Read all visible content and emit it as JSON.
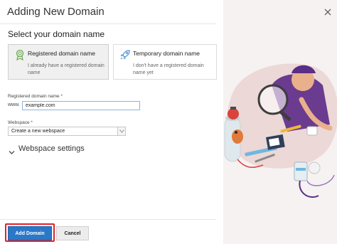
{
  "dialog": {
    "title": "Adding New Domain",
    "section_title": "Select your domain name",
    "close_icon": "close-icon"
  },
  "cards": [
    {
      "title": "Registered domain name",
      "description": "I already have a registered domain name",
      "icon": "award-badge-icon",
      "selected": true
    },
    {
      "title": "Temporary domain name",
      "description": "I don't have a registered domain name yet",
      "icon": "rocket-icon",
      "selected": false
    }
  ],
  "form": {
    "domain_label": "Registered domain name",
    "required_mark": "*",
    "domain_prefix": "www.",
    "domain_value": "example.com",
    "webspace_label": "Webspace",
    "webspace_value": "Create a new webspace"
  },
  "expander": {
    "label": "Webspace settings",
    "icon": "chevron-down-icon"
  },
  "footer": {
    "primary_label": "Add Domain",
    "secondary_label": "Cancel"
  },
  "colors": {
    "primary": "#2a78c8",
    "highlight": "#e0212b",
    "illustration_bg": "#f5f2f1"
  }
}
